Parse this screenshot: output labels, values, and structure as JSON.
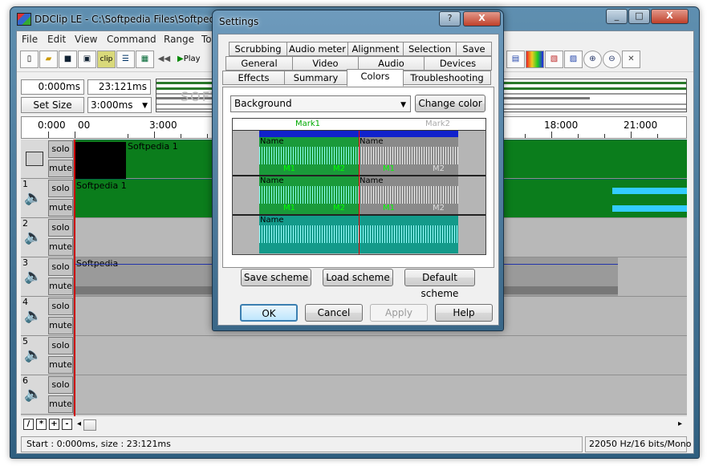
{
  "app": {
    "title": "DDClip LE - C:\\Softpedia Files\\Softpedia 1",
    "controls": {
      "minimize": "_",
      "maximize": "□",
      "close": "X"
    }
  },
  "menu": [
    "File",
    "Edit",
    "View",
    "Command",
    "Range",
    "To"
  ],
  "toolbar": {
    "clip_label": "clip",
    "play_label": "Play",
    "left_icons": [
      "new-file-icon",
      "open-folder-icon",
      "save-icon",
      "save-all-icon",
      "clip-icon",
      "film-list-icon",
      "film-icon",
      "rewind-icon",
      "play-icon"
    ],
    "right_icons": [
      "effects-icon",
      "color-bars-icon",
      "cut-icon",
      "paste-icon",
      "zoom-in-icon",
      "zoom-out-icon",
      "tools-icon"
    ]
  },
  "position": {
    "start": "0:000ms",
    "length": "23:121ms",
    "size_button": "Set Size",
    "size_value": "3:000ms"
  },
  "overview_watermark": "SOFTPEDIA",
  "ruler": {
    "labels": [
      "0:000",
      "3:000",
      "18:000",
      "21:000"
    ],
    "partial_label": "00"
  },
  "tracks": [
    {
      "num": "",
      "icon": "monitor-icon",
      "solo": "solo",
      "mute": "mute",
      "clip": "Softpedia 1"
    },
    {
      "num": "1",
      "icon": "speaker-icon",
      "solo": "solo",
      "mute": "mute",
      "clip": "Softpedia 1"
    },
    {
      "num": "2",
      "icon": "speaker-icon",
      "solo": "solo",
      "mute": "mute",
      "clip": ""
    },
    {
      "num": "3",
      "icon": "speaker-icon",
      "solo": "solo",
      "mute": "mute",
      "clip": "Softpedia"
    },
    {
      "num": "4",
      "icon": "speaker-icon",
      "solo": "solo",
      "mute": "mute",
      "clip": ""
    },
    {
      "num": "5",
      "icon": "speaker-icon",
      "solo": "solo",
      "mute": "mute",
      "clip": ""
    },
    {
      "num": "6",
      "icon": "speaker-icon",
      "solo": "solo",
      "mute": "mute",
      "clip": ""
    }
  ],
  "scroll_buttons": [
    "/",
    "*",
    "+",
    "-"
  ],
  "status": {
    "left": "Start : 0:000ms,  size : 23:121ms",
    "right": "22050 Hz/16 bits/Mono"
  },
  "dialog": {
    "title": "Settings",
    "help_glyph": "?",
    "close_glyph": "X",
    "tabs_row1": [
      "Scrubbing",
      "Audio meter",
      "Alignment",
      "Selection",
      "Save"
    ],
    "tabs_row2": [
      "General",
      "Video",
      "Audio",
      "Devices"
    ],
    "tabs_row3": [
      "Effects",
      "Summary",
      "Colors",
      "Troubleshooting"
    ],
    "active_tab": "Colors",
    "element": "Background",
    "change_color": "Change color",
    "preview": {
      "marks": [
        "Mark1",
        "Mark2"
      ],
      "clip_name": "Name",
      "marker_labels": [
        "M1",
        "M2"
      ]
    },
    "scheme_buttons": {
      "save": "Save scheme",
      "load": "Load scheme",
      "default": "Default scheme"
    },
    "buttons": {
      "ok": "OK",
      "cancel": "Cancel",
      "apply": "Apply",
      "help": "Help"
    }
  }
}
